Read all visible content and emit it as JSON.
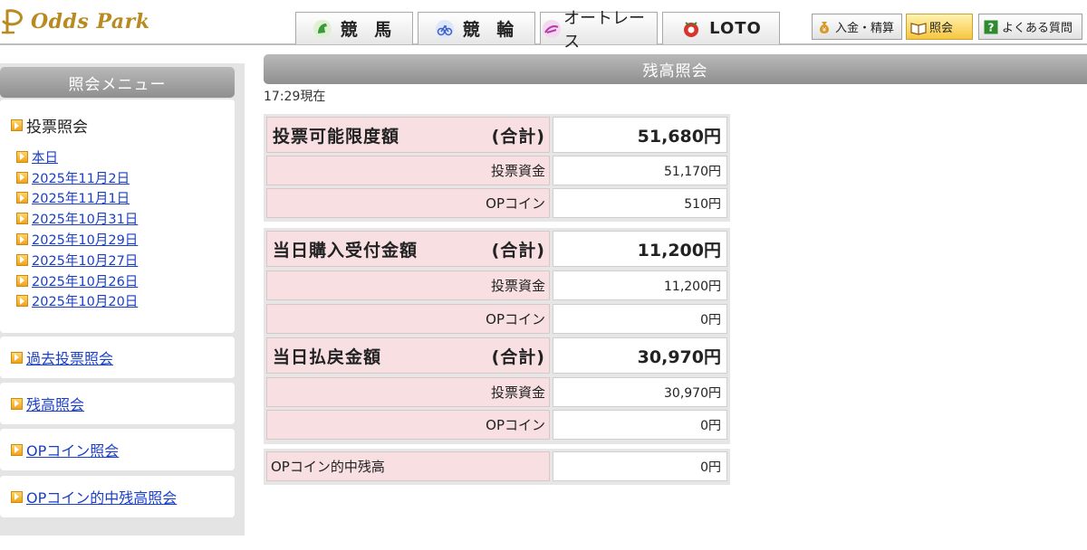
{
  "header": {
    "logo_text": "Odds Park",
    "nav_tabs": [
      {
        "label": "競 馬",
        "icon": "horse-icon"
      },
      {
        "label": "競 輪",
        "icon": "bicycle-icon"
      },
      {
        "label": "オートレース",
        "icon": "motorcycle-icon"
      },
      {
        "label": "LOTO",
        "icon": "loto-ball-icon"
      }
    ],
    "buttons": [
      {
        "label": "入金・精算",
        "icon": "money-bag-icon"
      },
      {
        "label": "照会",
        "icon": "book-icon",
        "active": true
      },
      {
        "label": "よくある質問",
        "icon": "question-icon"
      }
    ]
  },
  "sidebar": {
    "title": "照会メニュー",
    "vote_inquiry": {
      "label": "投票照会",
      "dates": [
        "本日",
        "2025年11月2日",
        "2025年11月1日",
        "2025年10月31日",
        "2025年10月29日",
        "2025年10月27日",
        "2025年10月26日",
        "2025年10月20日"
      ]
    },
    "links": [
      "過去投票照会",
      "残高照会",
      "OPコイン照会",
      "OPコイン的中残高照会"
    ]
  },
  "main": {
    "title": "残高照会",
    "as_of": "17:29現在",
    "sections": [
      {
        "title": "投票可能限度額",
        "total_label": "(合計)",
        "total": "51,680円",
        "rows": [
          {
            "label": "投票資金",
            "value": "51,170円"
          },
          {
            "label": "OPコイン",
            "value": "510円"
          }
        ]
      },
      {
        "title": "当日購入受付金額",
        "total_label": "(合計)",
        "total": "11,200円",
        "rows": [
          {
            "label": "投票資金",
            "value": "11,200円"
          },
          {
            "label": "OPコイン",
            "value": "0円"
          }
        ]
      },
      {
        "title": "当日払戻金額",
        "total_label": "(合計)",
        "total": "30,970円",
        "rows": [
          {
            "label": "投票資金",
            "value": "30,970円"
          },
          {
            "label": "OPコイン",
            "value": "0円"
          }
        ]
      }
    ],
    "op_hit_balance": {
      "label": "OPコイン的中残高",
      "value": "0円"
    }
  },
  "colors": {
    "accent": "#f0a21a",
    "link": "#1a3fc4",
    "row_pink": "#f7dfe2",
    "logo_gold": "#b88a20"
  }
}
